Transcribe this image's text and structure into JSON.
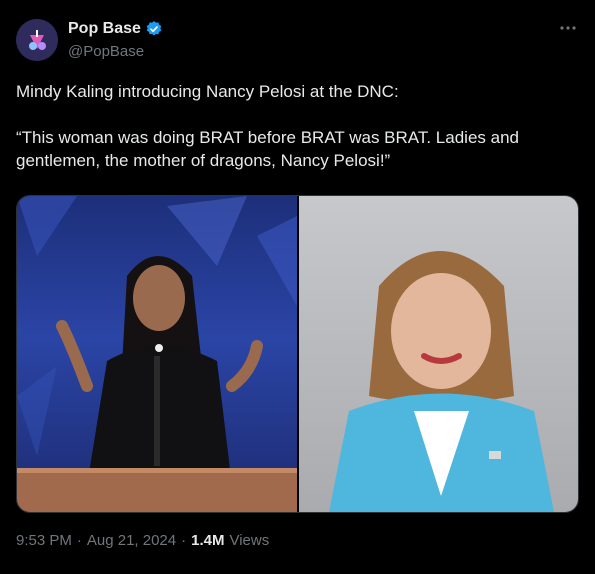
{
  "account": {
    "name": "Pop Base",
    "handle": "@PopBase",
    "verified_color": "#1d9bf0"
  },
  "tweet": {
    "paragraphs": [
      "Mindy Kaling introducing Nancy Pelosi at the DNC:",
      "“This woman was doing BRAT before BRAT was BRAT. Ladies and gentlemen, the mother of dragons, Nancy Pelosi!”"
    ],
    "images": [
      {
        "alt": "Mindy Kaling speaking at a podium on a blue stage"
      },
      {
        "alt": "Portrait of Nancy Pelosi in a light blue jacket"
      }
    ]
  },
  "meta": {
    "time": "9:53 PM",
    "separator": "·",
    "date": "Aug 21, 2024",
    "views_count": "1.4M",
    "views_label": "Views"
  },
  "more_icon": "more-horizontal-icon"
}
